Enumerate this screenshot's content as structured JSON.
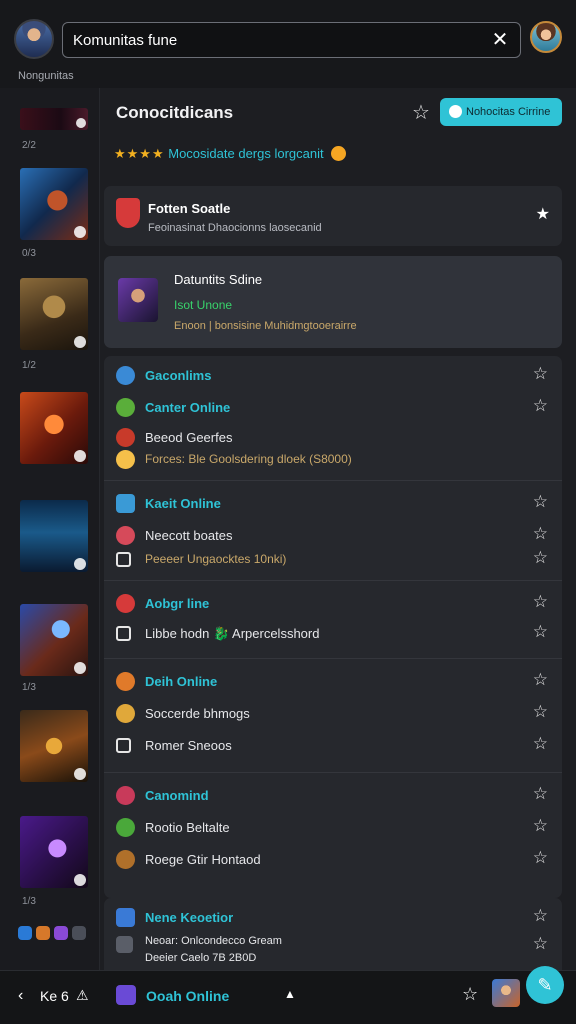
{
  "header": {
    "search_value": "Komunitas fune",
    "subtitle": "Nongunitas"
  },
  "sidebar": {
    "captions": [
      "2/2",
      "0/3",
      "1/2",
      "1/3",
      "1/3"
    ]
  },
  "main": {
    "title": "Conocitdicans",
    "cta_label": "Nohocitas Cirrine",
    "rating_text": "Mocosidate dergs lorgcanit",
    "featured": {
      "title": "Fotten Soatle",
      "subtitle": "Feoinasinat Dhaocionns laosecanid"
    },
    "now_playing": {
      "title": "Datuntits Sdine",
      "status": "Isot Unone",
      "detail": "Enoon | bonsisine Muhidmgtooerairre"
    },
    "groups": [
      {
        "rows": [
          {
            "label": "Gaconlims",
            "style": "accent"
          },
          {
            "label": "Canter Online",
            "style": "accent"
          },
          {
            "label": "Beeod Geerfes",
            "style": "normal"
          },
          {
            "label": "Forces: Ble Goolsdering dloek (S8000)",
            "style": "dim"
          }
        ]
      },
      {
        "rows": [
          {
            "label": "Kaeit Online",
            "style": "accent"
          },
          {
            "label": "Neecott boates",
            "style": "normal"
          },
          {
            "label": "Peeeer Ungaocktes 10nki)",
            "style": "dim"
          }
        ]
      },
      {
        "rows": [
          {
            "label": "Aobgr line",
            "style": "accent"
          },
          {
            "label": "Libbe hodn 🐉 Arpercelsshord",
            "style": "normal"
          }
        ]
      },
      {
        "rows": [
          {
            "label": "Deih Online",
            "style": "accent"
          },
          {
            "label": "Soccerde bhmogs",
            "style": "normal"
          },
          {
            "label": "Romer Sneoos",
            "style": "normal"
          }
        ]
      },
      {
        "rows": [
          {
            "label": "Canomind",
            "style": "accent"
          },
          {
            "label": "Rootio Beltalte",
            "style": "normal"
          },
          {
            "label": "Roege Gtir Hontaod",
            "style": "normal"
          }
        ]
      },
      {
        "rows": [
          {
            "label": "Nene Keoetior",
            "style": "accent"
          },
          {
            "label": "Neoar: Onlcondecco Gream",
            "style": "normal"
          },
          {
            "label": "Deeier Caelo 7B 2B0D",
            "style": "normal"
          }
        ]
      }
    ]
  },
  "bottom": {
    "left_text": "Ke 6",
    "center_label": "Ooah Online"
  },
  "icons": {
    "close": "close-icon",
    "star": "star-icon",
    "cta": "chat-icon",
    "fab": "edit-icon",
    "back": "chevron-left-icon",
    "up": "chevron-up-icon"
  },
  "colors": {
    "accent": "#2fc3d6",
    "star_rating": "#f2b020",
    "background": "#1d1e22",
    "card": "#26282d",
    "status_green": "#38d36b"
  }
}
